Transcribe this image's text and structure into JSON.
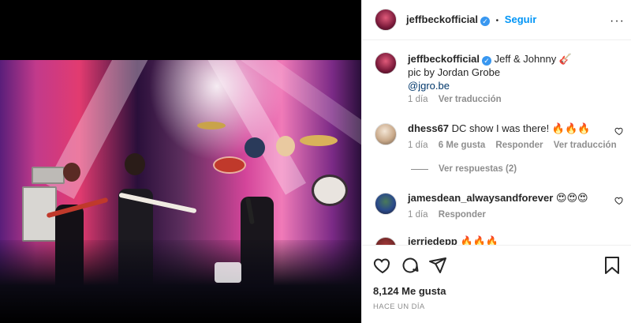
{
  "header": {
    "username": "jeffbeckofficial",
    "dot": "•",
    "follow_label": "Seguir"
  },
  "caption": {
    "username": "jeffbeckofficial",
    "text": "Jeff & Johnny 🎸",
    "line2": "pic by Jordan Grobe",
    "mention": "@jgro.be",
    "time": "1 día",
    "translate": "Ver traducción"
  },
  "comments": [
    {
      "username": "dhess67",
      "text": "DC show I was there! 🔥🔥🔥",
      "time": "1 día",
      "likes": "6 Me gusta",
      "reply": "Responder",
      "translate": "Ver traducción"
    },
    {
      "username": "jamesdean_alwaysandforever",
      "text": "😍😍😍",
      "time": "1 día",
      "reply": "Responder"
    },
    {
      "username": "jerriedepp",
      "text": "🔥🔥🔥"
    }
  ],
  "replies_toggle": "Ver respuestas (2)",
  "actions": {
    "like_icon": "heart-icon",
    "comment_icon": "comment-icon",
    "share_icon": "paper-plane-icon"
  },
  "likes_count": "8,124 Me gusta",
  "posted_ago": "HACE UN DÍA",
  "colors": {
    "accent": "#0095f6",
    "verified": "#3897f0",
    "secondary_text": "#8e8e8e"
  }
}
